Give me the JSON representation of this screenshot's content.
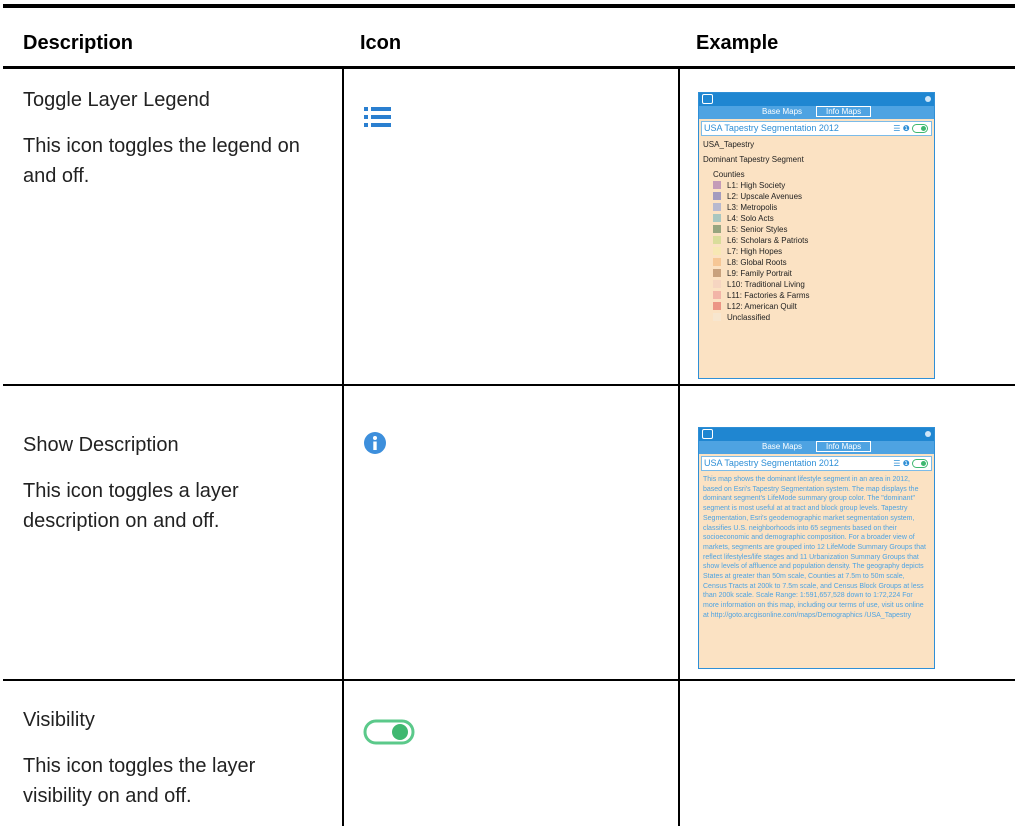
{
  "headers": {
    "description": "Description",
    "icon": "Icon",
    "example": "Example"
  },
  "rows": [
    {
      "title": "Toggle Layer Legend",
      "text": "This icon toggles the legend on and off.",
      "icon": "list-icon"
    },
    {
      "title": "Show Description",
      "text": "This icon toggles a layer description on and off.",
      "icon": "info-icon"
    },
    {
      "title": "Visibility",
      "text": "This icon toggles the layer visibility on and off.",
      "icon": "toggle-switch-icon"
    }
  ],
  "panel": {
    "tab_base": "Base Maps",
    "tab_info": "Info Maps",
    "layer_name": "USA Tapestry Segmentation 2012",
    "layer_id": "USA_Tapestry",
    "segment_label": "Dominant Tapestry Segment",
    "group_label": "Counties",
    "legend": [
      {
        "label": "L1: High Society",
        "color": "#c49bb8"
      },
      {
        "label": "L2: Upscale Avenues",
        "color": "#a39bbf"
      },
      {
        "label": "L3: Metropolis",
        "color": "#b7b9cf"
      },
      {
        "label": "L4: Solo Acts",
        "color": "#a9c7c0"
      },
      {
        "label": "L5: Senior Styles",
        "color": "#97a57f"
      },
      {
        "label": "L6: Scholars & Patriots",
        "color": "#d9dd9b"
      },
      {
        "label": "L7: High Hopes",
        "color": "#f7e8b4"
      },
      {
        "label": "L8: Global Roots",
        "color": "#f6c796"
      },
      {
        "label": "L9: Family Portrait",
        "color": "#c8a27e"
      },
      {
        "label": "L10: Traditional Living",
        "color": "#f6d5c1"
      },
      {
        "label": "L11: Factories & Farms",
        "color": "#f2b5a8"
      },
      {
        "label": "L12: American Quilt",
        "color": "#ec9585"
      },
      {
        "label": "Unclassified",
        "color": "#f7e6cf"
      }
    ],
    "description": "This map shows the dominant lifestyle segment in an area in 2012, based on Esri's Tapestry Segmentation system. The map displays the dominant segment's LifeMode summary group color. The \"dominant\" segment is most useful at at tract and block group levels. Tapestry Segmentation, Esri's geodemographic market segmentation system, classifies U.S. neighborhoods into 65 segments based on their socioeconomic and demographic composition. For a broader view of markets, segments are grouped into 12 LifeMode Summary Groups that reflect lifestyles/life stages and 11 Urbanization Summary Groups that show levels of affluence and population density. The geography depicts States at greater than 50m scale, Counties at 7.5m to 50m scale, Census Tracts at 200k to 7.5m scale, and Census Block Groups at less than 200k scale. Scale Range: 1:591,657,528 down to 1:72,224 For more information on this map, including our terms of use, visit us online at http://goto.arcgisonline.com/maps/Demographics /USA_Tapestry"
  },
  "colors": {
    "accent_blue": "#1f86d1",
    "panel_bg": "#fbe2c3",
    "toggle_green": "#3fb870"
  }
}
